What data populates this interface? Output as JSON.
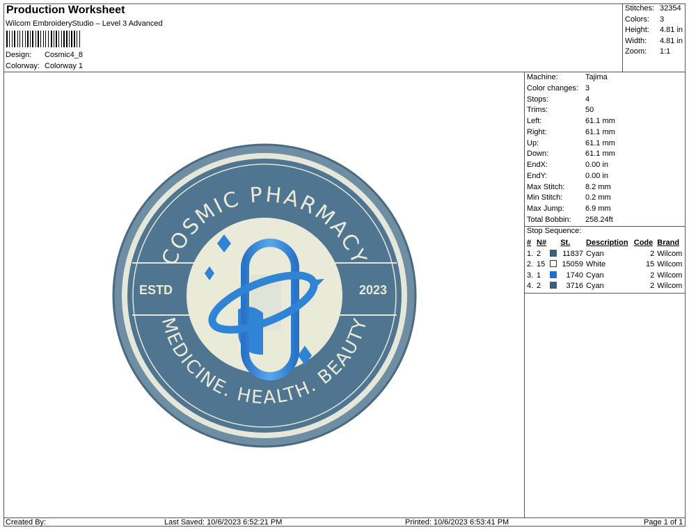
{
  "header": {
    "title": "Production Worksheet",
    "software": "Wilcom EmbroideryStudio – Level 3 Advanced",
    "design_label": "Design:",
    "design_value": "Cosmic4_8",
    "colorway_label": "Colorway:",
    "colorway_value": "Colorway 1"
  },
  "stats": [
    {
      "label": "Stitches:",
      "value": "32354"
    },
    {
      "label": "Colors:",
      "value": "3"
    },
    {
      "label": "Height:",
      "value": "4.81 in"
    },
    {
      "label": "Width:",
      "value": "4.81 in"
    },
    {
      "label": "Zoom:",
      "value": "1:1"
    }
  ],
  "machine_info": [
    {
      "label": "Machine:",
      "value": "Tajima"
    },
    {
      "label": "Color changes:",
      "value": "3"
    },
    {
      "label": "Stops:",
      "value": "4"
    },
    {
      "label": "Trims:",
      "value": "50"
    },
    {
      "label": "Left:",
      "value": "61.1 mm"
    },
    {
      "label": "Right:",
      "value": "61.1 mm"
    },
    {
      "label": "Up:",
      "value": "61.1 mm"
    },
    {
      "label": "Down:",
      "value": "61.1 mm"
    },
    {
      "label": "EndX:",
      "value": "0.00 in"
    },
    {
      "label": "EndY:",
      "value": "0.00 in"
    },
    {
      "label": "Max Stitch:",
      "value": "8.2 mm"
    },
    {
      "label": "Min Stitch:",
      "value": "0.2 mm"
    },
    {
      "label": "Max Jump:",
      "value": "6.9 mm"
    },
    {
      "label": "Total Bobbin:",
      "value": "258.24ft"
    }
  ],
  "stop_sequence": {
    "title": "Stop Sequence:",
    "headers": {
      "idx": "#",
      "n": "N#",
      "st": "St.",
      "desc": "Description",
      "code": "Code",
      "brand": "Brand"
    },
    "rows": [
      {
        "idx": "1.",
        "n": "2",
        "color": "#3f5e78",
        "st": "11837",
        "desc": "Cyan",
        "code": "2",
        "brand": "Wilcom"
      },
      {
        "idx": "2.",
        "n": "15",
        "color": "#ffffff",
        "st": "15059",
        "desc": "White",
        "code": "15",
        "brand": "Wilcom"
      },
      {
        "idx": "3.",
        "n": "1",
        "color": "#1f6fd1",
        "st": "1740",
        "desc": "Cyan",
        "code": "2",
        "brand": "Wilcom"
      },
      {
        "idx": "4.",
        "n": "2",
        "color": "#3f5e78",
        "st": "3716",
        "desc": "Cyan",
        "code": "2",
        "brand": "Wilcom"
      }
    ]
  },
  "design": {
    "top_text": "COSMIC PHARMACY",
    "bottom_text": "MEDICINE. HEALTH. BEAUTY",
    "left_text": "ESTD",
    "right_text": "2023",
    "ring_color": "#4f7590",
    "outer_color": "#6f8da3",
    "cream_color": "#e9ead8",
    "accent_color": "#2f84d6"
  },
  "footer": {
    "created_by": "Created By:",
    "last_saved": "Last Saved: 10/6/2023 6:52:21 PM",
    "printed": "Printed: 10/6/2023 6:53:41 PM",
    "page": "Page 1 of 1"
  }
}
